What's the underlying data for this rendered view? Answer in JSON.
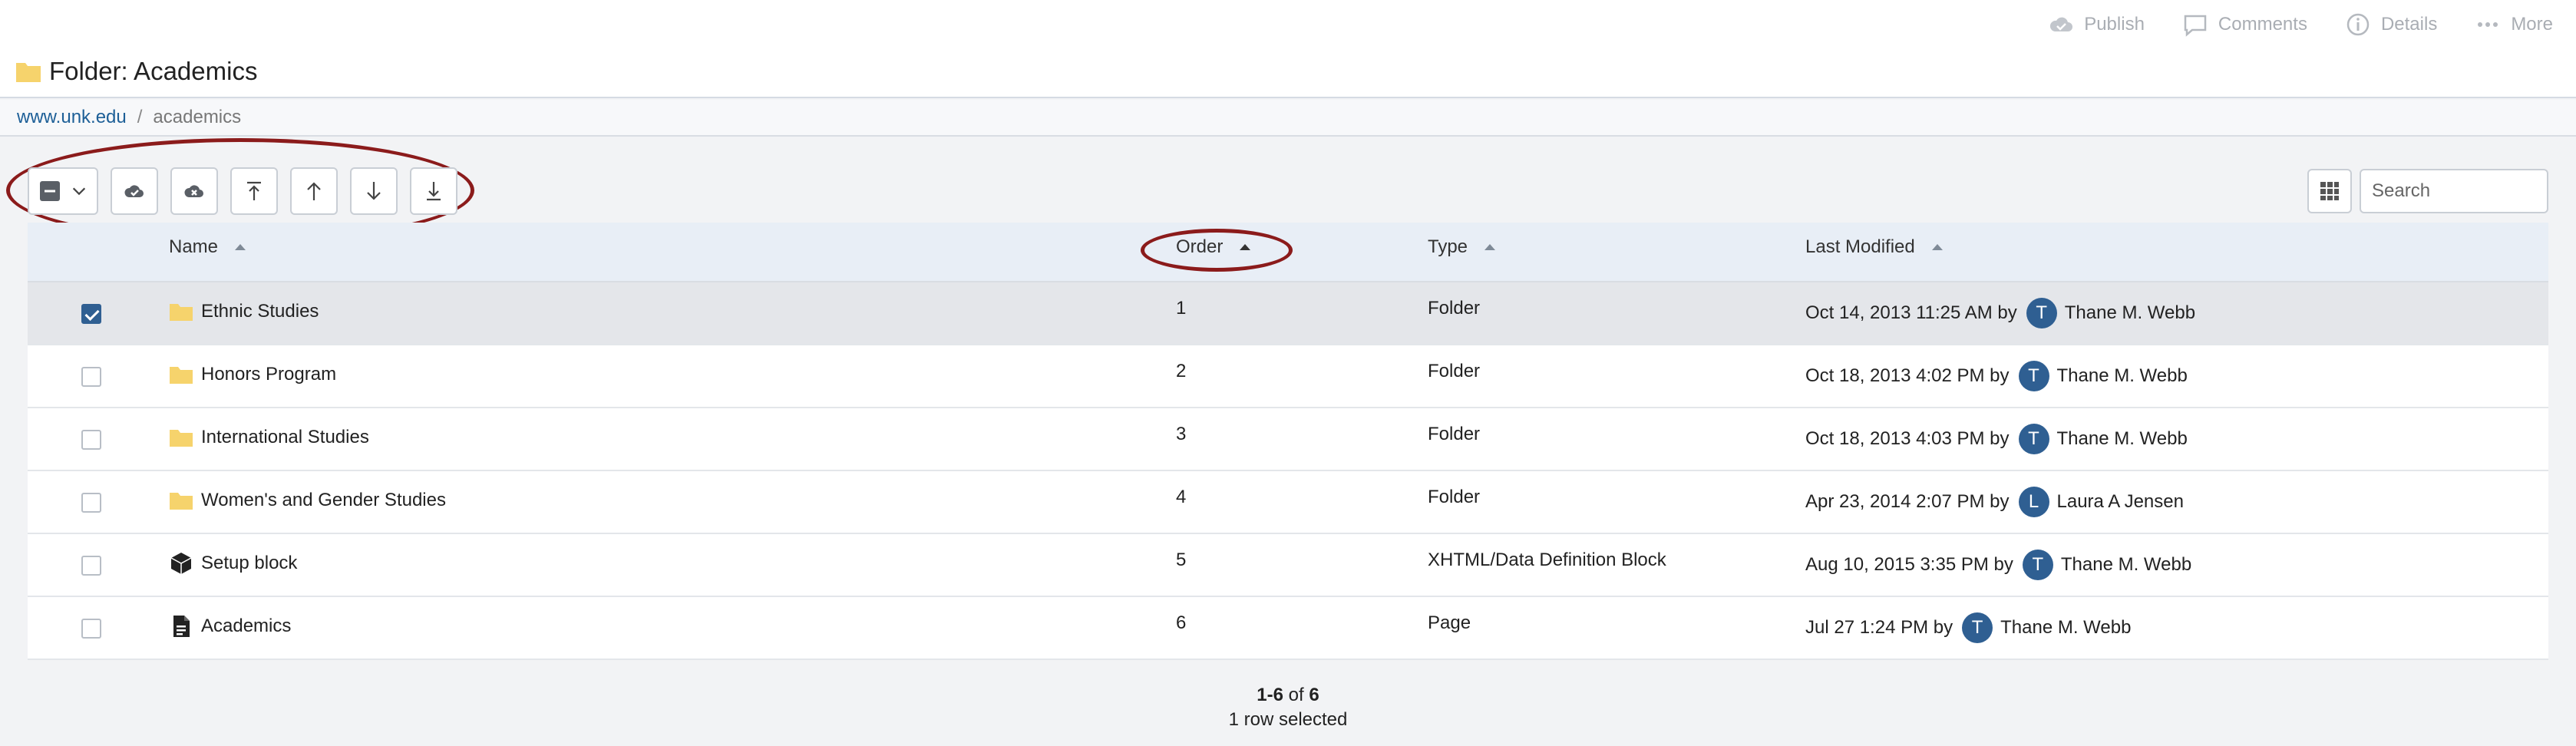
{
  "top_actions": [
    {
      "label": "Publish",
      "icon": "cloud-check-icon"
    },
    {
      "label": "Comments",
      "icon": "comment-icon"
    },
    {
      "label": "Details",
      "icon": "info-icon"
    },
    {
      "label": "More",
      "icon": "ellipsis-icon"
    }
  ],
  "page_title": "Folder: Academics",
  "breadcrumb": {
    "root": "www.unk.edu",
    "separator": "/",
    "current": "academics"
  },
  "search": {
    "placeholder": "Search"
  },
  "columns": {
    "name": "Name",
    "order": "Order",
    "type": "Type",
    "last_modified": "Last Modified"
  },
  "rows": [
    {
      "name": "Ethnic Studies",
      "icon": "folder-icon",
      "order": "1",
      "type": "Folder",
      "modified": "Oct 14, 2013 11:25 AM by",
      "user": "Thane M. Webb",
      "initial": "T",
      "selected": true
    },
    {
      "name": "Honors Program",
      "icon": "folder-icon",
      "order": "2",
      "type": "Folder",
      "modified": "Oct 18, 2013 4:02 PM by",
      "user": "Thane M. Webb",
      "initial": "T",
      "selected": false
    },
    {
      "name": "International Studies",
      "icon": "folder-icon",
      "order": "3",
      "type": "Folder",
      "modified": "Oct 18, 2013 4:03 PM by",
      "user": "Thane M. Webb",
      "initial": "T",
      "selected": false
    },
    {
      "name": "Women's and Gender Studies",
      "icon": "folder-icon",
      "order": "4",
      "type": "Folder",
      "modified": "Apr 23, 2014 2:07 PM by",
      "user": "Laura A Jensen",
      "initial": "L",
      "selected": false
    },
    {
      "name": "Setup block",
      "icon": "block-cube-icon",
      "order": "5",
      "type": "XHTML/Data Definition Block",
      "modified": "Aug 10, 2015 3:35 PM by",
      "user": "Thane M. Webb",
      "initial": "T",
      "selected": false
    },
    {
      "name": "Academics",
      "icon": "page-document-icon",
      "order": "6",
      "type": "Page",
      "modified": "Jul 27 1:24 PM by",
      "user": "Thane M. Webb",
      "initial": "T",
      "selected": false
    }
  ],
  "pagination": {
    "range": "1-6",
    "of_word": "of",
    "total": "6",
    "selection": "1 row selected"
  },
  "colors": {
    "accent": "#2f5f92",
    "annotation": "#8b1b1b",
    "folder": "#f6d36c",
    "link": "#1d5f97"
  }
}
